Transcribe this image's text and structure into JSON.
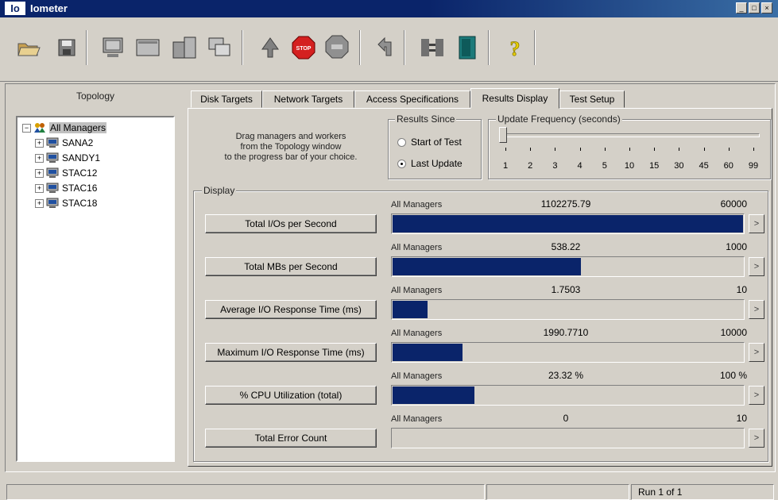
{
  "window": {
    "title": "Iometer",
    "app_icon_text": "Io"
  },
  "toolbar": {
    "buttons": [
      "open-icon",
      "save-icon",
      "new-disk-worker-icon",
      "new-network-worker-icon",
      "new-manager-icon",
      "duplicate-worker-icon",
      "start-icon",
      "stop-icon",
      "stop-all-icon",
      "reset-workers-icon",
      "disconnect-icon",
      "exit-icon",
      "about-icon"
    ],
    "stop_label": "STOP"
  },
  "topology": {
    "label": "Topology",
    "root": "All Managers",
    "managers": [
      "SANA2",
      "SANDY1",
      "STAC12",
      "STAC16",
      "STAC18"
    ]
  },
  "tabs": [
    "Disk Targets",
    "Network Targets",
    "Access Specifications",
    "Results Display",
    "Test Setup"
  ],
  "active_tab": "Results Display",
  "results": {
    "hint_lines": [
      "Drag managers and workers",
      "from the Topology window",
      "to the progress bar of your choice."
    ],
    "results_since": {
      "title": "Results Since",
      "options": [
        "Start of Test",
        "Last Update"
      ],
      "selected": "Last Update"
    },
    "update_frequency": {
      "title": "Update Frequency (seconds)",
      "ticks": [
        "1",
        "2",
        "3",
        "4",
        "5",
        "10",
        "15",
        "30",
        "45",
        "60",
        "99"
      ],
      "selected_index": 0
    },
    "display_title": "Display",
    "metrics": [
      {
        "label": "Total I/Os per Second",
        "manager": "All Managers",
        "value": "1102275.79",
        "max": "60000",
        "fill": 1.0
      },
      {
        "label": "Total MBs per Second",
        "manager": "All Managers",
        "value": "538.22",
        "max": "1000",
        "fill": 0.538
      },
      {
        "label": "Average I/O Response Time (ms)",
        "manager": "All Managers",
        "value": "1.7503",
        "max": "10",
        "fill": 0.1
      },
      {
        "label": "Maximum I/O Response Time (ms)",
        "manager": "All Managers",
        "value": "1990.7710",
        "max": "10000",
        "fill": 0.199
      },
      {
        "label": "% CPU Utilization (total)",
        "manager": "All Managers",
        "value": "23.32 %",
        "max": "100 %",
        "fill": 0.233
      },
      {
        "label": "Total Error Count",
        "manager": "All Managers",
        "value": "0",
        "max": "10",
        "fill": 0.0
      }
    ],
    "arrow_glyph": ">"
  },
  "status": {
    "run": "Run 1 of 1"
  },
  "colors": {
    "bar": "#0a246a",
    "face": "#d4d0c8",
    "title_bar": "#0a246a"
  }
}
